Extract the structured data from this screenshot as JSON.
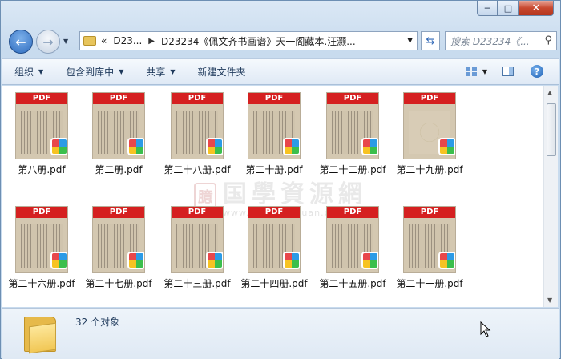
{
  "window": {
    "caption": {
      "minimize_glyph": "─",
      "maximize_glyph": "□",
      "close_glyph": "✕"
    }
  },
  "nav": {
    "back_icon": "arrow-left",
    "forward_icon": "arrow-right",
    "address": {
      "overflow": "«",
      "segment_1": "D23...",
      "segment_2": "D23234《佩文齐书画谱》天一阁藏本.汪灏..."
    },
    "refresh_icon": "refresh",
    "search_placeholder": "搜索 D23234《..."
  },
  "toolbar": {
    "organize": "组织",
    "include_in_library": "包含到库中",
    "share": "共享",
    "new_folder": "新建文件夹",
    "help_glyph": "?"
  },
  "files": [
    {
      "name": "第八册.pdf",
      "badge": "PDF",
      "thumb": "page"
    },
    {
      "name": "第二册.pdf",
      "badge": "PDF",
      "thumb": "page"
    },
    {
      "name": "第二十八册.pdf",
      "badge": "PDF",
      "thumb": "page"
    },
    {
      "name": "第二十册.pdf",
      "badge": "PDF",
      "thumb": "page"
    },
    {
      "name": "第二十二册.pdf",
      "badge": "PDF",
      "thumb": "page"
    },
    {
      "name": "第二十九册.pdf",
      "badge": "PDF",
      "thumb": "blank"
    },
    {
      "name": "第二十六册.pdf",
      "badge": "PDF",
      "thumb": "page"
    },
    {
      "name": "第二十七册.pdf",
      "badge": "PDF",
      "thumb": "page"
    },
    {
      "name": "第二十三册.pdf",
      "badge": "PDF",
      "thumb": "page"
    },
    {
      "name": "第二十四册.pdf",
      "badge": "PDF",
      "thumb": "page"
    },
    {
      "name": "第二十五册.pdf",
      "badge": "PDF",
      "thumb": "page"
    },
    {
      "name": "第二十一册.pdf",
      "badge": "PDF",
      "thumb": "page"
    }
  ],
  "watermark": {
    "seal": "臆",
    "text": "国學資源網",
    "url": "www.guoxueziyuan.com"
  },
  "details": {
    "item_count": "32 个对象"
  },
  "colors": {
    "pdf_band": "#d52020",
    "window_frame": "#c8dbee",
    "content_bg": "#ffffff"
  }
}
